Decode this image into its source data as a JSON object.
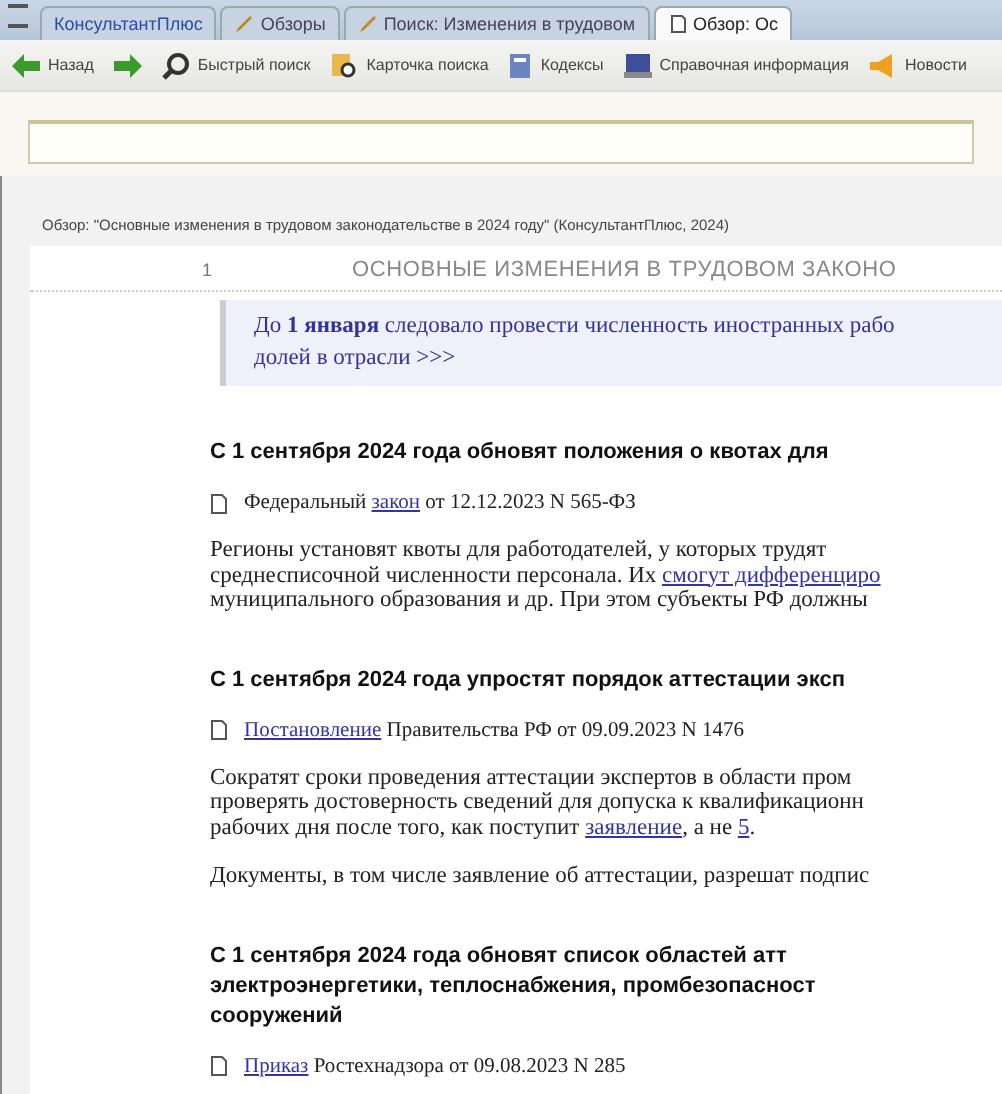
{
  "tabs": [
    {
      "label": "КонсультантПлюс",
      "selected": false
    },
    {
      "label": "Обзоры",
      "selected": false
    },
    {
      "label": "Поиск: Изменения в трудовом",
      "selected": false
    },
    {
      "label": "Обзор: Ос",
      "selected": true
    }
  ],
  "toolbar": [
    {
      "kind": "labeled",
      "label": "Назад"
    },
    {
      "kind": "icon"
    },
    {
      "kind": "labeled",
      "label": "Быстрый поиск"
    },
    {
      "kind": "labeled",
      "label": "Карточка поиска"
    },
    {
      "kind": "labeled",
      "label": "Кодексы"
    },
    {
      "kind": "labeled",
      "label": "Справочная информация"
    },
    {
      "kind": "labeled",
      "label": "Новости"
    }
  ],
  "breadcrumb": "Обзор: \"Основные изменения в трудовом законодательстве в 2024 году\" (КонсультантПлюс, 2024)",
  "document": {
    "page_number": "1",
    "title": "ОСНОВНЫЕ ИЗМЕНЕНИЯ В ТРУДОВОМ ЗАКОНО",
    "intro": [
      "До **1 января** следовало провести численность иностранных рабо",
      "долей в отрасли >>>"
    ],
    "blocks": [
      {
        "kind": "heading",
        "lines": [
          "С 1 сентября 2024 года обновят положения о квотах для"
        ]
      },
      {
        "kind": "source",
        "parts": [
          {
            "kind": "text",
            "text": "Федеральный "
          },
          {
            "kind": "link",
            "text": "закон"
          },
          {
            "kind": "text",
            "text": " от 12.12.2023 N 565-ФЗ"
          }
        ]
      },
      {
        "kind": "paragraph",
        "lines": [
          [
            {
              "kind": "text",
              "text": "Регионы установят квоты для работодателей, у которых трудят"
            }
          ],
          [
            {
              "kind": "text",
              "text": "среднесписочной численности персонала. Их "
            },
            {
              "kind": "link",
              "text": "смогут дифференциро"
            }
          ],
          [
            {
              "kind": "text",
              "text": "муниципального образования и др. При этом субъекты РФ должны"
            }
          ]
        ]
      },
      {
        "kind": "heading",
        "lines": [
          "С 1 сентября 2024 года упростят порядок аттестации эксп"
        ]
      },
      {
        "kind": "source",
        "parts": [
          {
            "kind": "link",
            "text": "Постановление"
          },
          {
            "kind": "text",
            "text": " Правительства РФ от 09.09.2023 N 1476"
          }
        ]
      },
      {
        "kind": "paragraph",
        "lines": [
          [
            {
              "kind": "text",
              "text": "Сократят сроки проведения аттестации экспертов в области пром"
            }
          ],
          [
            {
              "kind": "text",
              "text": "проверять достоверность сведений для допуска к квалификационн"
            }
          ],
          [
            {
              "kind": "text",
              "text": "рабочих дня после того, как поступит "
            },
            {
              "kind": "link",
              "text": "заявление"
            },
            {
              "kind": "text",
              "text": ", а не "
            },
            {
              "kind": "link",
              "text": "5"
            },
            {
              "kind": "text",
              "text": "."
            }
          ]
        ]
      },
      {
        "kind": "paragraph",
        "lines": [
          [
            {
              "kind": "text",
              "text": "Документы, в том числе заявление об аттестации, разрешат подпис"
            }
          ]
        ]
      },
      {
        "kind": "heading",
        "lines": [
          "С 1 сентября 2024 года обновят список областей атт",
          "электроэнергетики, теплоснабжения, промбезопасност",
          "сооружений"
        ]
      },
      {
        "kind": "source",
        "parts": [
          {
            "kind": "link",
            "text": "Приказ"
          },
          {
            "kind": "text",
            "text": " Ростехнадзора от 09.08.2023 N 285"
          }
        ]
      }
    ]
  }
}
